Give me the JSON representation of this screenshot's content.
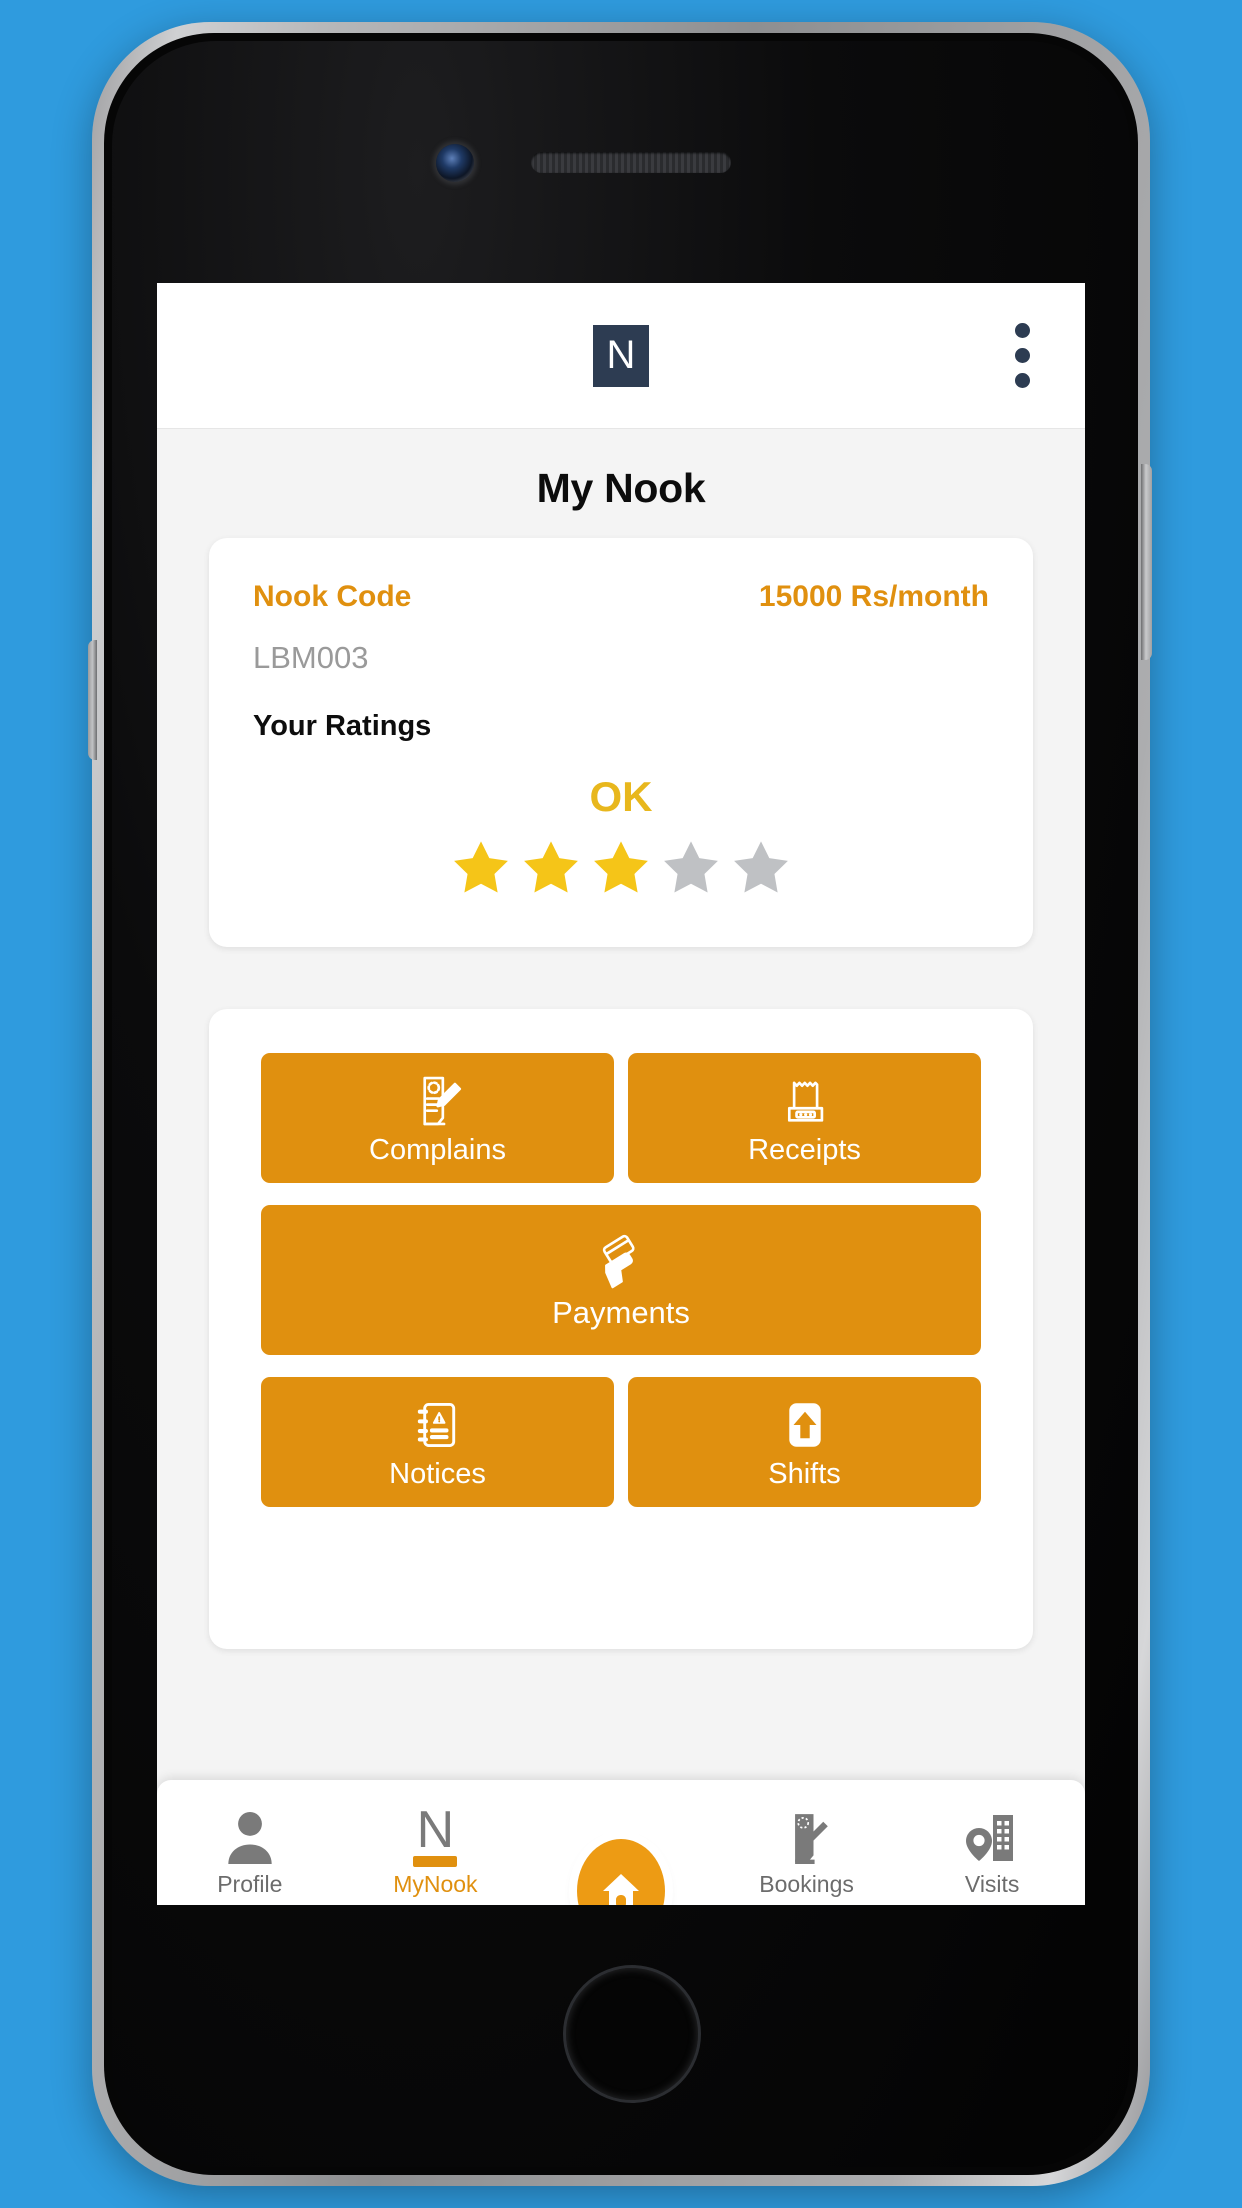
{
  "theme": {
    "background": "#2f9bde",
    "accent_orange": "#e0900f",
    "star_gold": "#f5c518",
    "star_gray": "#bfc1c4",
    "brand_navy": "#2d3c52",
    "muted_gray": "#9a9a9a"
  },
  "appbar": {
    "logo_letter": "N",
    "logo_name": "nook-logo",
    "overflow_menu_name": "overflow-menu-icon"
  },
  "page": {
    "title": "My Nook"
  },
  "nook_card": {
    "code_label": "Nook Code",
    "price": "15000 Rs/month",
    "code_value": "LBM003",
    "ratings_label": "Your Ratings",
    "rating_word": "OK",
    "rating_value": 3,
    "rating_max": 5
  },
  "actions": {
    "rows": [
      [
        {
          "label": "Complains",
          "icon": "document-pencil-icon"
        },
        {
          "label": "Receipts",
          "icon": "receipt-printer-icon"
        }
      ],
      [
        {
          "label": "Payments",
          "icon": "hand-card-icon"
        }
      ],
      [
        {
          "label": "Notices",
          "icon": "notebook-alert-icon"
        },
        {
          "label": "Shifts",
          "icon": "arrow-up-box-icon"
        }
      ]
    ]
  },
  "bottom_nav": {
    "items": [
      {
        "label": "Profile",
        "icon": "person-icon",
        "active": false
      },
      {
        "label": "MyNook",
        "icon": "letter-n-icon",
        "active": true
      },
      {
        "label": "Home",
        "icon": "house-icon",
        "active": false
      },
      {
        "label": "Bookings",
        "icon": "clipboard-pencil-icon",
        "active": false
      },
      {
        "label": "Visits",
        "icon": "building-pin-icon",
        "active": false
      }
    ]
  }
}
